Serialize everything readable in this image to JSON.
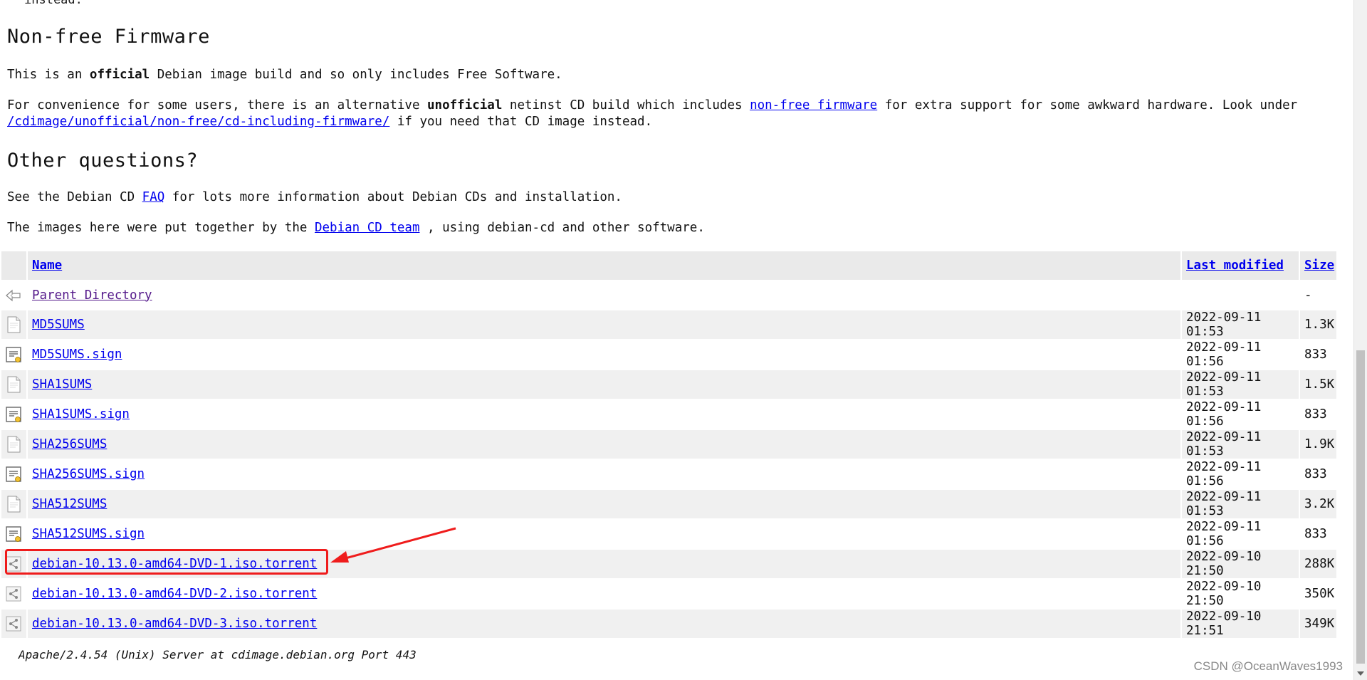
{
  "top_cut_text": "instead.",
  "sections": {
    "nonfree": {
      "heading": "Non-free Firmware",
      "p1": {
        "pre": "This is an ",
        "bold": "official",
        "post": " Debian image build and so only includes Free Software."
      },
      "p2": {
        "pre": "For convenience for some users, there is an alternative ",
        "bold": "unofficial",
        "mid": " netinst CD build which includes ",
        "link1": "non-free firmware",
        "mid2": " for extra support for some awkward hardware. Look under",
        "link2": "/cdimage/unofficial/non-free/cd-including-firmware/",
        "post": " if you need that CD image instead."
      }
    },
    "other": {
      "heading": "Other questions?",
      "p1": {
        "pre": "See the Debian CD ",
        "link": "FAQ",
        "post": " for lots more information about Debian CDs and installation."
      },
      "p2": {
        "pre": "The images here were put together by the ",
        "link": "Debian CD team",
        "post": " , using debian-cd and other software."
      }
    }
  },
  "listing": {
    "columns": {
      "name": "Name",
      "modified": "Last modified",
      "size": "Size"
    },
    "parent": {
      "name": "Parent Directory",
      "size": "-"
    },
    "rows": [
      {
        "name": "MD5SUMS",
        "modified": "2022-09-11 01:53",
        "size": "1.3K",
        "icon": "text-file-icon"
      },
      {
        "name": "MD5SUMS.sign",
        "modified": "2022-09-11 01:56",
        "size": "833",
        "icon": "signature-file-icon"
      },
      {
        "name": "SHA1SUMS",
        "modified": "2022-09-11 01:53",
        "size": "1.5K",
        "icon": "text-file-icon"
      },
      {
        "name": "SHA1SUMS.sign",
        "modified": "2022-09-11 01:56",
        "size": "833",
        "icon": "signature-file-icon"
      },
      {
        "name": "SHA256SUMS",
        "modified": "2022-09-11 01:53",
        "size": "1.9K",
        "icon": "text-file-icon"
      },
      {
        "name": "SHA256SUMS.sign",
        "modified": "2022-09-11 01:56",
        "size": "833",
        "icon": "signature-file-icon"
      },
      {
        "name": "SHA512SUMS",
        "modified": "2022-09-11 01:53",
        "size": "3.2K",
        "icon": "text-file-icon"
      },
      {
        "name": "SHA512SUMS.sign",
        "modified": "2022-09-11 01:56",
        "size": "833",
        "icon": "signature-file-icon"
      },
      {
        "name": "debian-10.13.0-amd64-DVD-1.iso.torrent",
        "modified": "2022-09-10 21:50",
        "size": "288K",
        "icon": "torrent-file-icon"
      },
      {
        "name": "debian-10.13.0-amd64-DVD-2.iso.torrent",
        "modified": "2022-09-10 21:50",
        "size": "350K",
        "icon": "torrent-file-icon"
      },
      {
        "name": "debian-10.13.0-amd64-DVD-3.iso.torrent",
        "modified": "2022-09-10 21:51",
        "size": "349K",
        "icon": "torrent-file-icon"
      }
    ]
  },
  "footer": "Apache/2.4.54 (Unix) Server at cdimage.debian.org Port 443",
  "watermark": "CSDN @OceanWaves1993",
  "annotation_color": "#ef1c1c"
}
